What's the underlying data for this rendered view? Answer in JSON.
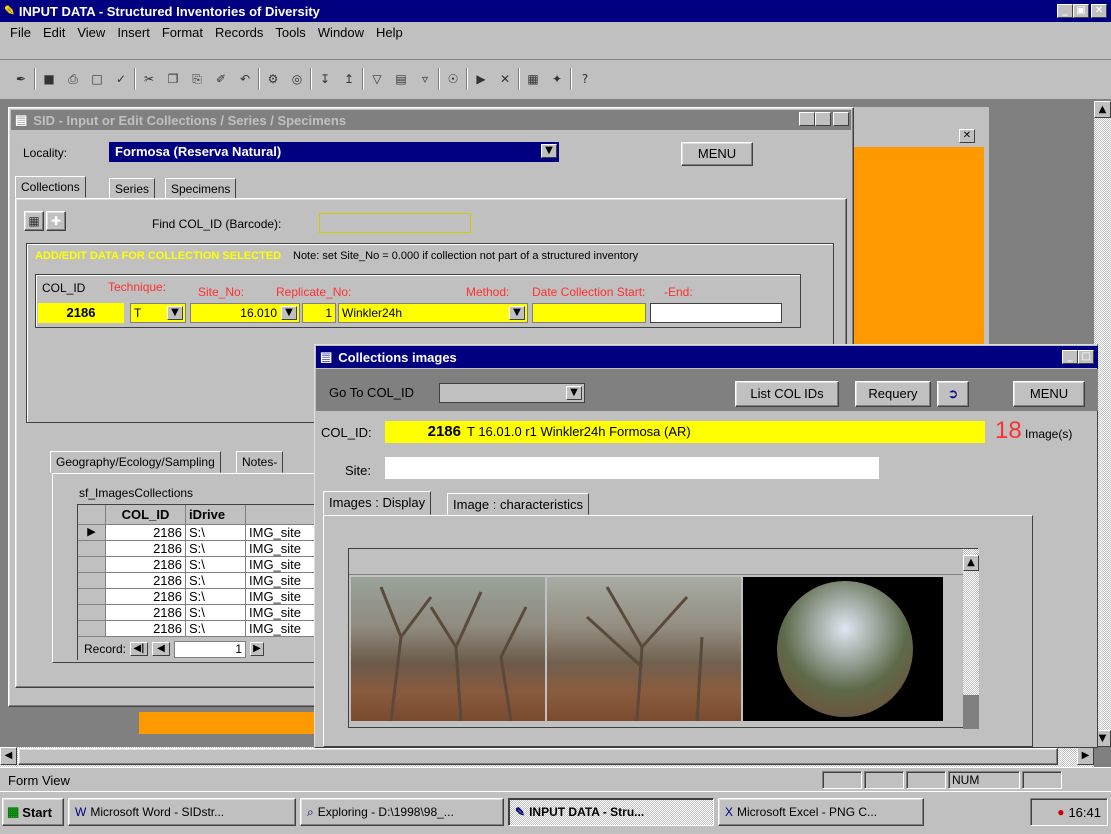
{
  "app": {
    "title": "INPUT DATA - Structured Inventories of Diversity"
  },
  "menubar": [
    "File",
    "Edit",
    "View",
    "Insert",
    "Format",
    "Records",
    "Tools",
    "Window",
    "Help"
  ],
  "toolbar_icons": [
    "design-view-icon",
    "save-icon",
    "print-icon",
    "print-preview-icon",
    "spell-check-icon",
    "cut-icon",
    "copy-icon",
    "paste-icon",
    "format-painter-icon",
    "undo-icon",
    "insert-hyperlink-icon",
    "web-toolbar-icon",
    "sort-ascending-icon",
    "sort-descending-icon",
    "filter-by-selection-icon",
    "filter-by-form-icon",
    "apply-filter-icon",
    "find-icon",
    "new-record-icon",
    "delete-record-icon",
    "database-window-icon",
    "new-object-icon",
    "help-icon"
  ],
  "sid": {
    "title": "SID -  Input or Edit Collections / Series / Specimens",
    "locality_label": "Locality:",
    "locality_value": "Formosa (Reserva Natural)",
    "menu_button": "MENU",
    "tabs": [
      "Collections",
      "Series",
      "Specimens"
    ],
    "find_label": "Find COL_ID (Barcode):",
    "banner": "ADD/EDIT DATA FOR COLLECTION SELECTED",
    "note": "Note: set Site_No = 0.000 if collection not part of a structured inventory",
    "headers": {
      "col_id": "COL_ID",
      "technique": "Technique:",
      "site_no": "Site_No:",
      "replicate_no": "Replicate_No:",
      "method": "Method:",
      "date_start": "Date Collection Start:",
      "date_end": "-End:"
    },
    "values": {
      "col_id": "2186",
      "technique": "T",
      "site_no": "16.010",
      "replicate_no": "1",
      "method": "Winkler24h",
      "date_start": "",
      "date_end": ""
    },
    "subtabs": [
      "Geography/Ecology/Sampling",
      "Notes-"
    ],
    "subform_label": "sf_ImagesCollections",
    "grid_headers": [
      "COL_ID",
      "iDrive",
      ""
    ],
    "grid_rows": [
      {
        "col_id": "2186",
        "drive": "S:\\",
        "name": "IMG_site"
      },
      {
        "col_id": "2186",
        "drive": "S:\\",
        "name": "IMG_site"
      },
      {
        "col_id": "2186",
        "drive": "S:\\",
        "name": "IMG_site"
      },
      {
        "col_id": "2186",
        "drive": "S:\\",
        "name": "IMG_site"
      },
      {
        "col_id": "2186",
        "drive": "S:\\",
        "name": "IMG_site"
      },
      {
        "col_id": "2186",
        "drive": "S:\\",
        "name": "IMG_site"
      },
      {
        "col_id": "2186",
        "drive": "S:\\",
        "name": "IMG_site"
      }
    ],
    "record_label": "Record:",
    "record_value": "1"
  },
  "images": {
    "title": "Collections images",
    "goto_label": "Go To COL_ID",
    "goto_value": "",
    "list_button": "List COL  IDs",
    "requery_button": "Requery",
    "menu_button": "MENU",
    "colid_label": "COL_ID:",
    "colid_value": "2186",
    "description": "T 16.01.0 r1 Winkler24h  Formosa (AR)",
    "count": "18",
    "count_label": "Image(s)",
    "site_label": "Site:",
    "site_value": "",
    "tabs": [
      "Images : Display",
      "Image : characteristics"
    ]
  },
  "status": {
    "mode": "Form View",
    "num": "NUM"
  },
  "taskbar": {
    "start": "Start",
    "items": [
      "Microsoft Word - SIDstr...",
      "Exploring - D:\\1998\\98_...",
      "INPUT DATA - Stru...",
      "Microsoft Excel - PNG C..."
    ],
    "clock": "16:41"
  },
  "colors": {
    "title_active": "#000080",
    "title_inactive": "#808080",
    "highlight": "#ffff00",
    "accent_orange": "#ff9900",
    "label_red": "#ff3030"
  }
}
